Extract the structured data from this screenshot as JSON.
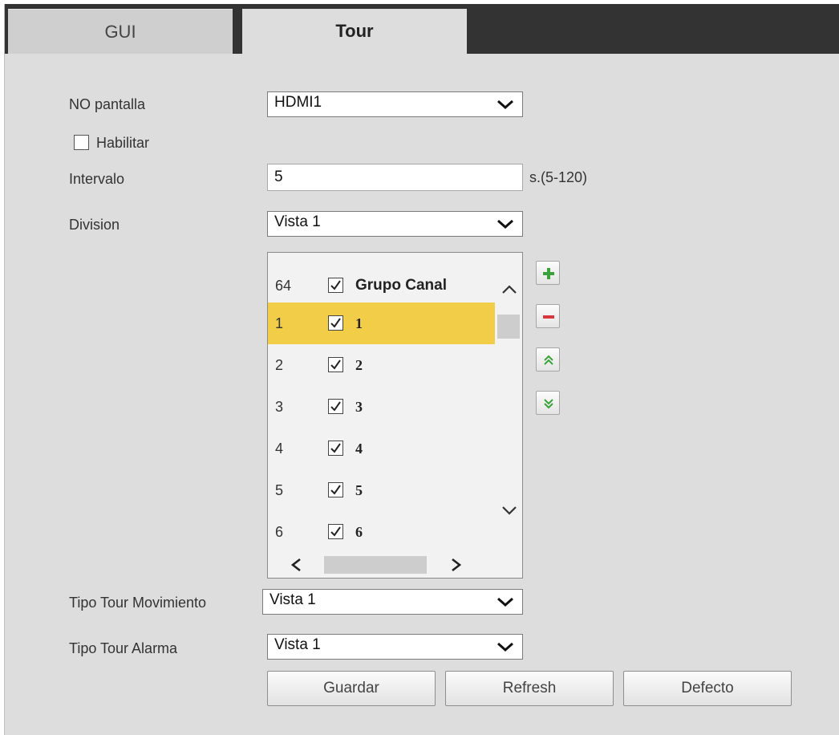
{
  "tabs": [
    {
      "label": "GUI",
      "active": false
    },
    {
      "label": "Tour",
      "active": true
    }
  ],
  "form": {
    "display_label": "NO pantalla",
    "display_value": "HDMI1",
    "enable_label": "Habilitar",
    "enable_checked": false,
    "interval_label": "Intervalo",
    "interval_value": "5",
    "interval_unit": "s.(5-120)",
    "division_label": "Division",
    "division_value": "Vista 1",
    "motion_tour_label": "Tipo Tour Movimiento",
    "motion_tour_value": "Vista 1",
    "alarm_tour_label": "Tipo Tour Alarma",
    "alarm_tour_value": "Vista 1"
  },
  "channel_list": {
    "header": {
      "num": "64",
      "name": "Grupo Canal",
      "checked": true
    },
    "rows": [
      {
        "num": "1",
        "name": "1",
        "checked": true,
        "selected": true
      },
      {
        "num": "2",
        "name": "2",
        "checked": true,
        "selected": false
      },
      {
        "num": "3",
        "name": "3",
        "checked": true,
        "selected": false
      },
      {
        "num": "4",
        "name": "4",
        "checked": true,
        "selected": false
      },
      {
        "num": "5",
        "name": "5",
        "checked": true,
        "selected": false
      },
      {
        "num": "6",
        "name": "6",
        "checked": true,
        "selected": false
      }
    ]
  },
  "tools": [
    "add-icon",
    "remove-icon",
    "move-up-icon",
    "move-down-icon"
  ],
  "buttons": {
    "save": "Guardar",
    "refresh": "Refresh",
    "default": "Defecto"
  },
  "colors": {
    "selected_row": "#f2cd47",
    "tab_bar": "#333333",
    "panel": "#dddddd",
    "add_icon": "#3aa23a",
    "remove_icon": "#d9363e"
  }
}
